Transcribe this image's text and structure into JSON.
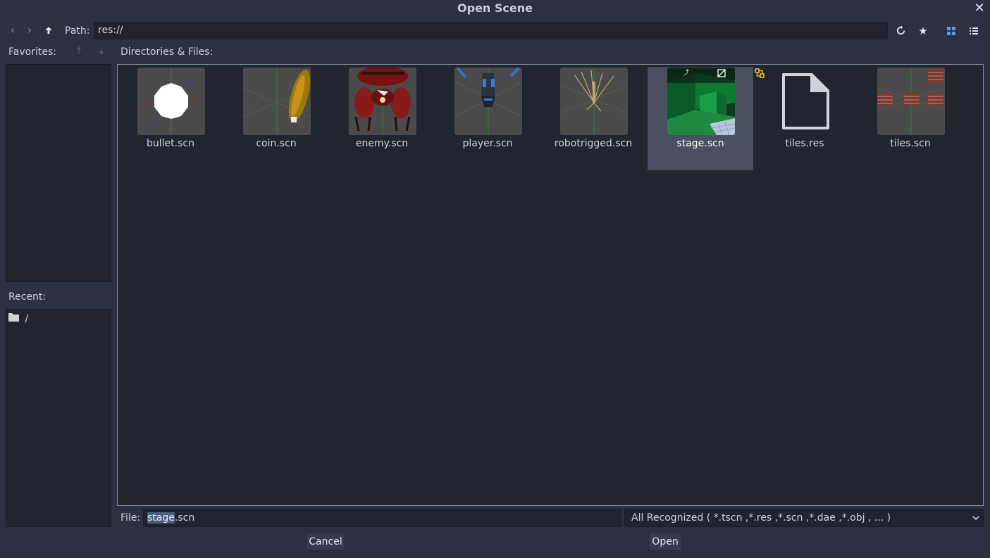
{
  "dialog": {
    "title": "Open Scene"
  },
  "toolbar": {
    "path_label": "Path:",
    "path_value": "res://"
  },
  "favorites": {
    "label": "Favorites:"
  },
  "recent": {
    "label": "Recent:",
    "items": [
      {
        "name": "/"
      }
    ]
  },
  "files": {
    "label": "Directories & Files:",
    "items": [
      {
        "name": "bullet.scn",
        "icon": "scene-thumbnail-bullet"
      },
      {
        "name": "coin.scn",
        "icon": "scene-thumbnail-coin"
      },
      {
        "name": "enemy.scn",
        "icon": "scene-thumbnail-enemy"
      },
      {
        "name": "player.scn",
        "icon": "scene-thumbnail-player"
      },
      {
        "name": "robotrigged.scn",
        "icon": "scene-thumbnail-robotrigged"
      },
      {
        "name": "stage.scn",
        "icon": "scene-thumbnail-stage",
        "selected": true
      },
      {
        "name": "tiles.res",
        "icon": "file-icon"
      },
      {
        "name": "tiles.scn",
        "icon": "scene-thumbnail-tiles"
      }
    ]
  },
  "footer": {
    "file_label": "File:",
    "file_selected": "stage",
    "file_rest": ".scn",
    "filter": "All Recognized ( *.tscn ,*.res ,*.scn ,*.dae ,*.obj , ... )",
    "cancel": "Cancel",
    "open": "Open"
  },
  "colors": {
    "background": "#2b3140",
    "panel": "#20252f",
    "selection": "#4a5060",
    "accent": "#5a9ae6"
  }
}
